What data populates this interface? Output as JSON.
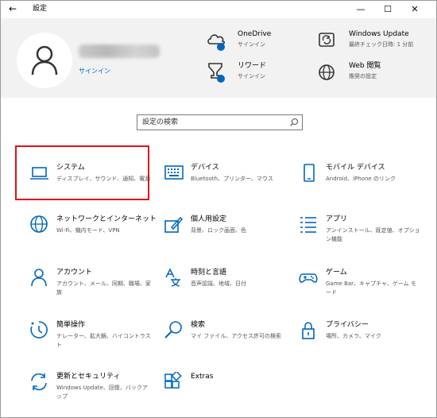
{
  "window": {
    "title": "設定",
    "back_glyph": "←",
    "minimize_glyph": "—",
    "maximize_glyph": "☐",
    "close_glyph": "✕"
  },
  "header": {
    "signin_label": "サインイン",
    "items": [
      {
        "title": "OneDrive",
        "subtitle": "サインイン",
        "icon": "cloud-icon"
      },
      {
        "title": "リワード",
        "subtitle": "サインイン",
        "icon": "trophy-icon"
      },
      {
        "title": "Windows Update",
        "subtitle": "最終チェック日時: 1 分前",
        "icon": "sync-icon"
      },
      {
        "title": "Web 閲覧",
        "subtitle": "推奨の設定",
        "icon": "globe-icon"
      }
    ]
  },
  "search": {
    "placeholder": "設定の検索"
  },
  "colors": {
    "accent": "#0067c0",
    "highlight": "#e0101a",
    "header_bg": "#f2f2f2"
  },
  "categories": [
    {
      "title": "システム",
      "desc": "ディスプレイ、サウンド、通知、電源",
      "icon": "laptop-icon"
    },
    {
      "title": "デバイス",
      "desc": "Bluetooth、プリンター、マウス",
      "icon": "keyboard-icon"
    },
    {
      "title": "モバイル デバイス",
      "desc": "Android、iPhone のリンク",
      "icon": "phone-icon"
    },
    {
      "title": "ネットワークとインターネット",
      "desc": "Wi-Fi、機内モード、VPN",
      "icon": "globe-icon"
    },
    {
      "title": "個人用設定",
      "desc": "背景、ロック画面、色",
      "icon": "paint-icon"
    },
    {
      "title": "アプリ",
      "desc": "アンインストール、既定値、オプション機能",
      "icon": "apps-list-icon"
    },
    {
      "title": "アカウント",
      "desc": "アカウント、メール、同期、職場、家族",
      "icon": "person-icon"
    },
    {
      "title": "時刻と言語",
      "desc": "音声認識、地域、日付",
      "icon": "time-language-icon"
    },
    {
      "title": "ゲーム",
      "desc": "Game Bar、キャプチャ、ゲーム モード",
      "icon": "gamepad-icon"
    },
    {
      "title": "簡単操作",
      "desc": "ナレーター、拡大鏡、ハイコントラスト",
      "icon": "ease-of-access-icon"
    },
    {
      "title": "検索",
      "desc": "マイ ファイル、アクセス許可の検索",
      "icon": "magnifier-icon"
    },
    {
      "title": "プライバシー",
      "desc": "場所、カメラ、マイク",
      "icon": "lock-icon"
    },
    {
      "title": "更新とセキュリティ",
      "desc": "Windows Update、回復、バックアップ",
      "icon": "refresh-icon"
    },
    {
      "title": "Extras",
      "desc": "",
      "icon": "extras-icon"
    }
  ]
}
